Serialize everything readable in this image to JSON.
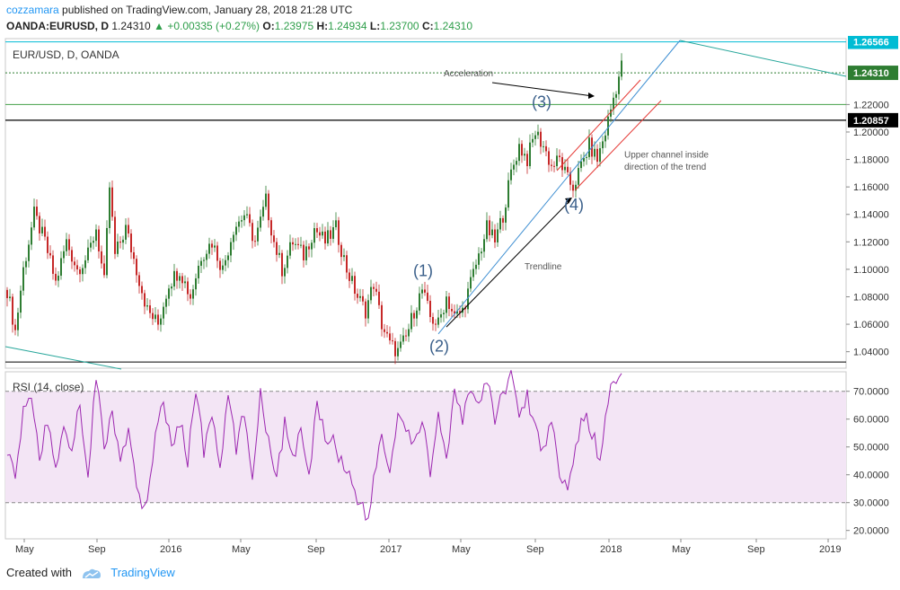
{
  "header": {
    "author": "cozzamara",
    "published_text": "published on TradingView.com, January 28, 2018 21:28 UTC",
    "symbol": "OANDA:EURUSD, D",
    "last": "1.24310",
    "change": "+0.00335 (+0.27%)",
    "o_label": "O:",
    "o_value": "1.23975",
    "h_label": "H:",
    "h_value": "1.24934",
    "l_label": "L:",
    "l_value": "1.23700",
    "c_label": "C:",
    "c_value": "1.24310"
  },
  "footer": {
    "created_with": "Created with",
    "brand": "TradingView"
  },
  "colors": {
    "up": "#2e7d32",
    "down": "#c62828",
    "rsi": "#9c27b0",
    "rsi_band": "#f3e5f5",
    "trendline_blue": "#3f8fd2",
    "channel_red": "#e53935"
  },
  "chart_data": {
    "type": "candlestick",
    "title": "EUR/USD, D, OANDA",
    "price_axis": {
      "ticks": [
        "1.04000",
        "1.06000",
        "1.08000",
        "1.10000",
        "1.12000",
        "1.14000",
        "1.16000",
        "1.18000",
        "1.20000",
        "1.22000"
      ],
      "ylim": [
        1.028,
        1.268
      ],
      "labels_badges": [
        "1.26566",
        "1.24310",
        "1.20857"
      ]
    },
    "time_axis": {
      "ticks": [
        "May",
        "Sep",
        "2016",
        "May",
        "Sep",
        "2017",
        "May",
        "Sep",
        "2018",
        "May",
        "Sep",
        "2019"
      ]
    },
    "horizontal_lines": [
      {
        "value": 1.26566,
        "label": "1.26566"
      },
      {
        "value": 1.2431,
        "label": "1.24310"
      },
      {
        "value": 1.22,
        "label": ""
      },
      {
        "value": 1.20857,
        "label": "1.20857"
      },
      {
        "value": 1.0325,
        "label": ""
      }
    ],
    "price_path": [
      [
        0,
        1.085
      ],
      [
        3,
        1.055
      ],
      [
        6,
        1.1
      ],
      [
        10,
        1.14
      ],
      [
        14,
        1.12
      ],
      [
        18,
        1.09
      ],
      [
        22,
        1.12
      ],
      [
        26,
        1.1
      ],
      [
        30,
        1.11
      ],
      [
        33,
        1.13
      ],
      [
        36,
        1.09
      ],
      [
        38,
        1.16
      ],
      [
        40,
        1.11
      ],
      [
        44,
        1.13
      ],
      [
        48,
        1.1
      ],
      [
        52,
        1.07
      ],
      [
        56,
        1.06
      ],
      [
        60,
        1.09
      ],
      [
        64,
        1.1
      ],
      [
        68,
        1.08
      ],
      [
        72,
        1.11
      ],
      [
        76,
        1.12
      ],
      [
        80,
        1.1
      ],
      [
        84,
        1.13
      ],
      [
        88,
        1.14
      ],
      [
        92,
        1.12
      ],
      [
        96,
        1.15
      ],
      [
        99,
        1.12
      ],
      [
        102,
        1.1
      ],
      [
        106,
        1.12
      ],
      [
        110,
        1.11
      ],
      [
        114,
        1.13
      ],
      [
        118,
        1.12
      ],
      [
        122,
        1.13
      ],
      [
        126,
        1.1
      ],
      [
        130,
        1.08
      ],
      [
        133,
        1.07
      ],
      [
        136,
        1.09
      ],
      [
        139,
        1.06
      ],
      [
        142,
        1.045
      ],
      [
        145,
        1.04
      ],
      [
        148,
        1.05
      ],
      [
        151,
        1.07
      ],
      [
        154,
        1.085
      ],
      [
        157,
        1.065
      ],
      [
        160,
        1.06
      ],
      [
        163,
        1.08
      ],
      [
        166,
        1.065
      ],
      [
        169,
        1.07
      ],
      [
        172,
        1.09
      ],
      [
        175,
        1.11
      ],
      [
        178,
        1.13
      ],
      [
        181,
        1.12
      ],
      [
        184,
        1.14
      ],
      [
        187,
        1.17
      ],
      [
        190,
        1.19
      ],
      [
        193,
        1.18
      ],
      [
        196,
        1.2
      ],
      [
        199,
        1.19
      ],
      [
        202,
        1.175
      ],
      [
        205,
        1.18
      ],
      [
        208,
        1.165
      ],
      [
        210,
        1.16
      ],
      [
        213,
        1.175
      ],
      [
        216,
        1.19
      ],
      [
        219,
        1.18
      ],
      [
        222,
        1.2
      ],
      [
        225,
        1.225
      ],
      [
        228,
        1.248
      ]
    ],
    "rsi": {
      "label": "RSI (14, close)",
      "ticks": [
        "70.0000",
        "60.0000",
        "50.0000",
        "40.0000",
        "30.0000",
        "20.0000"
      ],
      "ylim": [
        17,
        77
      ],
      "upper": 70,
      "lower": 30,
      "path": [
        [
          0,
          50
        ],
        [
          3,
          38
        ],
        [
          6,
          62
        ],
        [
          9,
          70
        ],
        [
          12,
          45
        ],
        [
          15,
          60
        ],
        [
          18,
          42
        ],
        [
          21,
          58
        ],
        [
          24,
          50
        ],
        [
          27,
          65
        ],
        [
          30,
          40
        ],
        [
          33,
          76
        ],
        [
          36,
          50
        ],
        [
          39,
          62
        ],
        [
          42,
          45
        ],
        [
          45,
          55
        ],
        [
          48,
          35
        ],
        [
          50,
          28
        ],
        [
          52,
          32
        ],
        [
          55,
          55
        ],
        [
          58,
          65
        ],
        [
          61,
          50
        ],
        [
          64,
          60
        ],
        [
          67,
          45
        ],
        [
          70,
          72
        ],
        [
          73,
          48
        ],
        [
          76,
          62
        ],
        [
          79,
          42
        ],
        [
          82,
          68
        ],
        [
          85,
          50
        ],
        [
          88,
          62
        ],
        [
          91,
          40
        ],
        [
          94,
          70
        ],
        [
          97,
          52
        ],
        [
          100,
          40
        ],
        [
          103,
          58
        ],
        [
          106,
          46
        ],
        [
          109,
          55
        ],
        [
          112,
          38
        ],
        [
          115,
          66
        ],
        [
          118,
          55
        ],
        [
          121,
          52
        ],
        [
          124,
          45
        ],
        [
          127,
          40
        ],
        [
          130,
          32
        ],
        [
          132,
          28
        ],
        [
          134,
          22
        ],
        [
          136,
          38
        ],
        [
          139,
          55
        ],
        [
          142,
          40
        ],
        [
          145,
          62
        ],
        [
          148,
          55
        ],
        [
          151,
          50
        ],
        [
          154,
          60
        ],
        [
          157,
          42
        ],
        [
          160,
          62
        ],
        [
          163,
          44
        ],
        [
          166,
          68
        ],
        [
          169,
          60
        ],
        [
          172,
          72
        ],
        [
          175,
          65
        ],
        [
          178,
          74
        ],
        [
          181,
          60
        ],
        [
          184,
          70
        ],
        [
          187,
          76
        ],
        [
          190,
          62
        ],
        [
          193,
          68
        ],
        [
          196,
          58
        ],
        [
          199,
          48
        ],
        [
          202,
          60
        ],
        [
          205,
          42
        ],
        [
          208,
          36
        ],
        [
          211,
          48
        ],
        [
          214,
          62
        ],
        [
          217,
          55
        ],
        [
          220,
          46
        ],
        [
          223,
          68
        ],
        [
          226,
          75
        ],
        [
          228,
          77
        ]
      ]
    },
    "annotations": [
      {
        "text": "(1)",
        "i": 154,
        "price": 1.095
      },
      {
        "text": "(2)",
        "i": 160,
        "price": 1.04
      },
      {
        "text": "(3)",
        "i": 198,
        "price": 1.218
      },
      {
        "text": "(4)",
        "i": 210,
        "price": 1.143
      },
      {
        "text": "Acceleration",
        "i": 162,
        "price": 1.2405
      },
      {
        "text": "Trendline",
        "i": 192,
        "price": 1.1
      },
      {
        "text": "Upper channel inside",
        "i": 229,
        "price": 1.1815
      },
      {
        "text": "direction of the trend",
        "i": 229,
        "price": 1.1725
      }
    ]
  }
}
